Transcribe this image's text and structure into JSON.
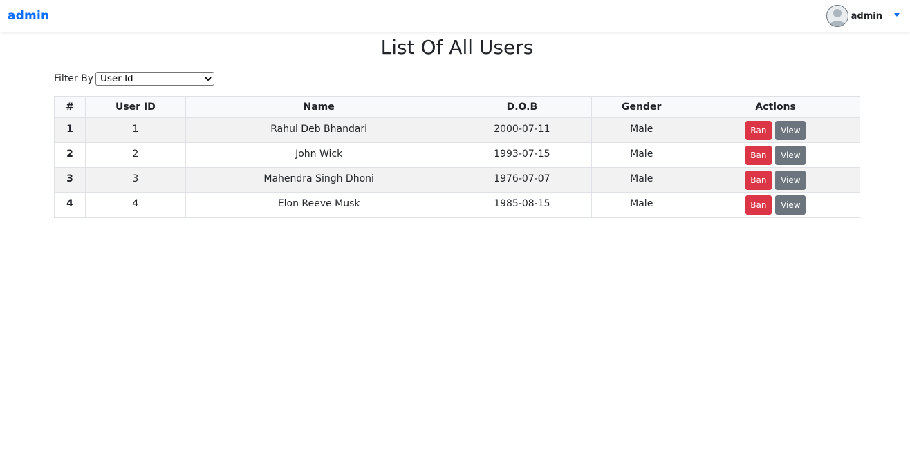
{
  "navbar": {
    "brand": "admin",
    "user_name": "admin"
  },
  "page": {
    "title": "List Of All Users"
  },
  "filter": {
    "label": "Filter By",
    "selected": "User Id"
  },
  "table": {
    "headers": [
      "#",
      "User ID",
      "Name",
      "D.O.B",
      "Gender",
      "Actions"
    ],
    "rows": [
      {
        "num": "1",
        "user_id": "1",
        "name": "Rahul Deb Bhandari",
        "dob": "2000-07-11",
        "gender": "Male"
      },
      {
        "num": "2",
        "user_id": "2",
        "name": "John Wick",
        "dob": "1993-07-15",
        "gender": "Male"
      },
      {
        "num": "3",
        "user_id": "3",
        "name": "Mahendra Singh Dhoni",
        "dob": "1976-07-07",
        "gender": "Male"
      },
      {
        "num": "4",
        "user_id": "4",
        "name": "Elon Reeve Musk",
        "dob": "1985-08-15",
        "gender": "Male"
      }
    ],
    "ban_label": "Ban",
    "view_label": "View"
  },
  "colors": {
    "brand": "#0d6efd",
    "ban": "#dc3545",
    "view": "#6c757d"
  }
}
